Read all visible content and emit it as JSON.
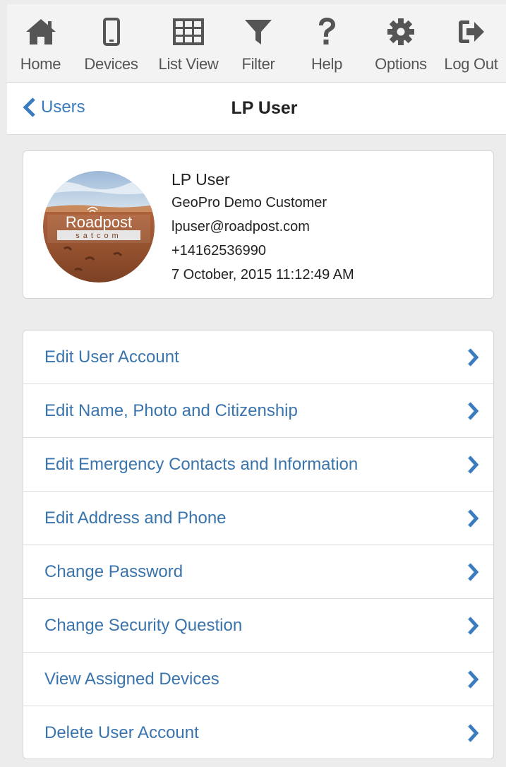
{
  "toolbar": {
    "items": [
      {
        "label": "Home",
        "icon": "home-icon"
      },
      {
        "label": "Devices",
        "icon": "phone-icon"
      },
      {
        "label": "List View",
        "icon": "grid-icon"
      },
      {
        "label": "Filter",
        "icon": "filter-icon"
      },
      {
        "label": "Help",
        "icon": "question-icon"
      },
      {
        "label": "Options",
        "icon": "gear-icon"
      },
      {
        "label": "Log Out",
        "icon": "logout-icon"
      }
    ]
  },
  "header": {
    "back_label": "Users",
    "title": "LP User"
  },
  "profile": {
    "name": "LP User",
    "company": "GeoPro Demo Customer",
    "email": "lpuser@roadpost.com",
    "phone": "+14162536990",
    "timestamp": "7 October, 2015 11:12:49 AM",
    "logo_text": "Roadpost",
    "logo_subtext": "satcom"
  },
  "menu": {
    "items": [
      {
        "label": "Edit User Account"
      },
      {
        "label": "Edit Name, Photo and Citizenship"
      },
      {
        "label": "Edit Emergency Contacts and Information"
      },
      {
        "label": "Edit Address and Phone"
      },
      {
        "label": "Change Password"
      },
      {
        "label": "Change Security Question"
      },
      {
        "label": "View Assigned Devices"
      },
      {
        "label": "Delete User Account"
      }
    ]
  },
  "colors": {
    "accent": "#3a7cbf",
    "icon": "#555555",
    "background": "#ececec"
  }
}
